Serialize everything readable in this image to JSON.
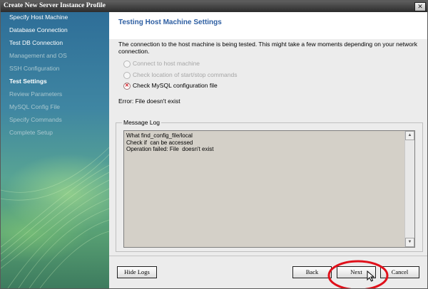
{
  "window": {
    "title": "Create New Server Instance Profile",
    "close_glyph": "✕"
  },
  "sidebar": {
    "steps": [
      {
        "label": "Specify Host Machine",
        "state": "done"
      },
      {
        "label": "Database Connection",
        "state": "done"
      },
      {
        "label": "Test DB Connection",
        "state": "done"
      },
      {
        "label": "Management and OS",
        "state": "pending"
      },
      {
        "label": "SSH Configuration",
        "state": "pending"
      },
      {
        "label": "Test Settings",
        "state": "active"
      },
      {
        "label": "Review Parameters",
        "state": "pending"
      },
      {
        "label": "MySQL Config File",
        "state": "pending"
      },
      {
        "label": "Specify Commands",
        "state": "pending"
      },
      {
        "label": "Complete Setup",
        "state": "pending"
      }
    ]
  },
  "main": {
    "title": "Testing Host Machine Settings",
    "description": "The connection to the host machine is being tested. This might take a few moments depending on your network connection.",
    "checks": [
      {
        "label": "Connect to host machine",
        "status": "pending"
      },
      {
        "label": "Check location of start/stop commands",
        "status": "pending"
      },
      {
        "label": "Check MySQL configuration file",
        "status": "error"
      }
    ],
    "error": "Error: File  doesn't exist",
    "log": {
      "label": "Message Log",
      "lines": "What find_config_file/local\nCheck if  can be accessed\nOperation failed: File  doesn't exist"
    }
  },
  "buttons": {
    "hide_logs": "Hide Logs",
    "back": "Back",
    "next": "Next",
    "cancel": "Cancel"
  },
  "colors": {
    "accent_title": "#2d5ea2",
    "error_icon": "#d0101a",
    "highlight": "#e0101a"
  },
  "icons": {
    "radio_error": "x-circle-icon",
    "cursor": "mouse-pointer-icon"
  }
}
